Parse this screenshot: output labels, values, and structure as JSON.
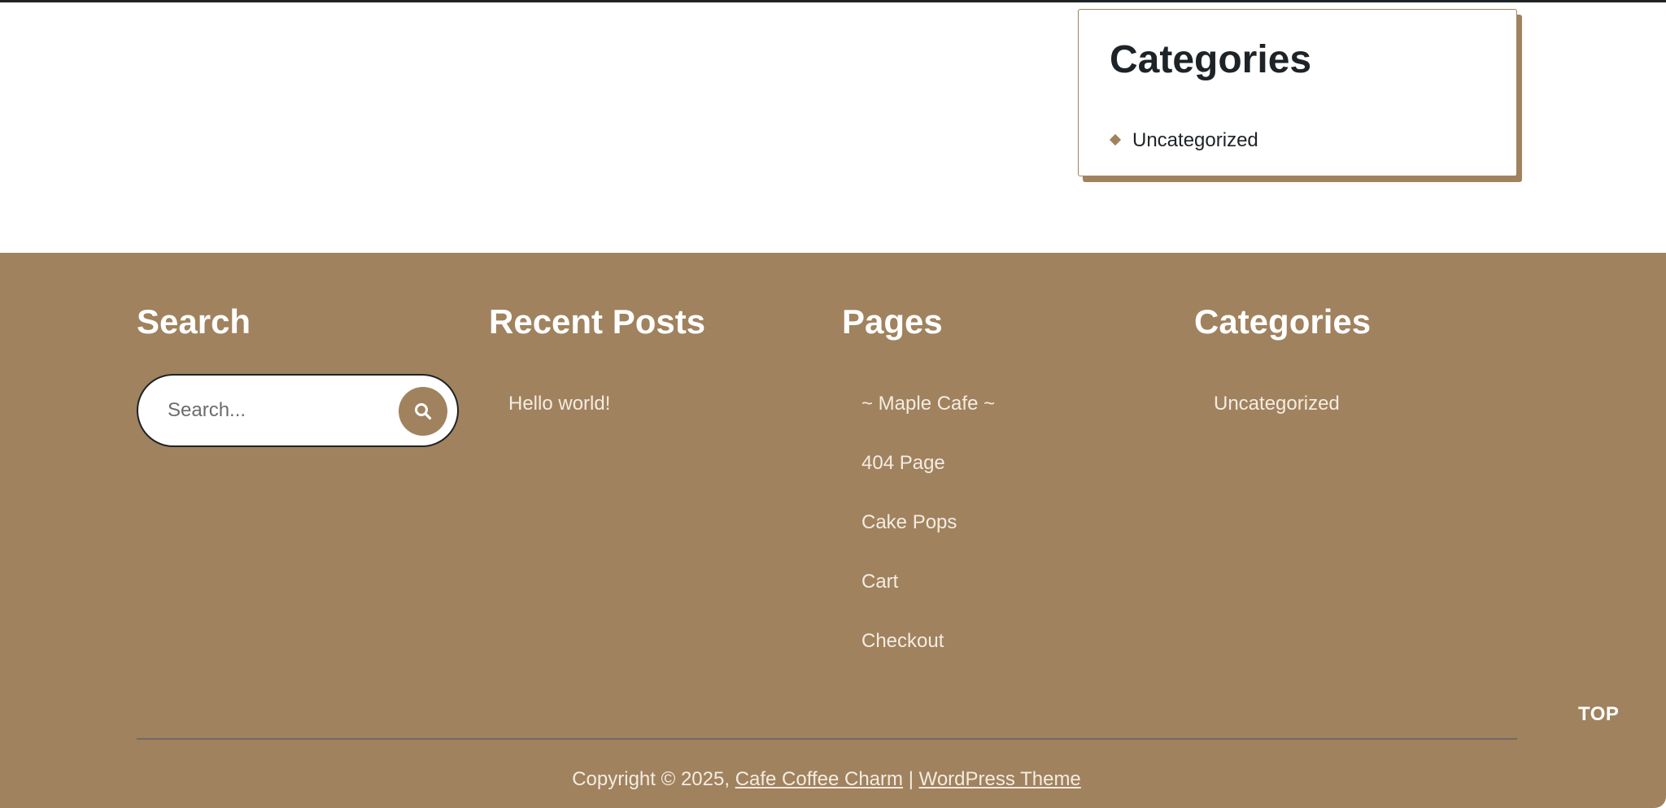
{
  "sidebar": {
    "title": "Categories",
    "items": [
      {
        "label": "Uncategorized"
      }
    ]
  },
  "footer": {
    "search": {
      "heading": "Search",
      "placeholder": "Search...",
      "button_icon": "search-icon"
    },
    "recent_posts": {
      "heading": "Recent Posts",
      "items": [
        {
          "label": "Hello world!"
        }
      ]
    },
    "pages": {
      "heading": "Pages",
      "items": [
        {
          "label": "~ Maple Cafe ~"
        },
        {
          "label": "404 Page"
        },
        {
          "label": "Cake Pops"
        },
        {
          "label": "Cart"
        },
        {
          "label": "Checkout"
        }
      ]
    },
    "categories": {
      "heading": "Categories",
      "items": [
        {
          "label": "Uncategorized"
        }
      ]
    },
    "top_label": "TOP",
    "copyright": {
      "prefix": "Copyright © 2025,",
      "site_link": "Cafe Coffee Charm",
      "separator": "|",
      "theme_link": "WordPress Theme"
    }
  },
  "colors": {
    "accent": "#a0825e",
    "text_dark": "#1e2327",
    "footer_text": "#f4ece2"
  }
}
